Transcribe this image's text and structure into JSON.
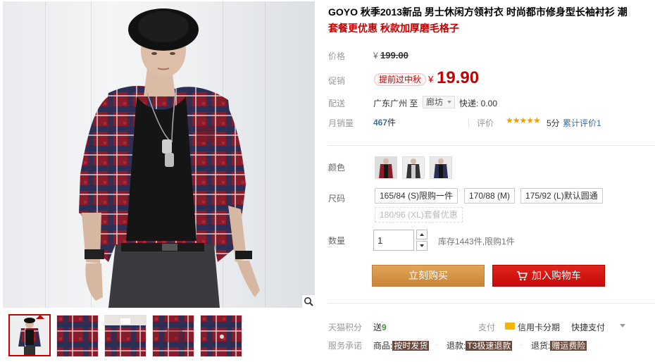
{
  "product": {
    "title": "GOYO 秋季2013新品 男士休闲方领衬衣 时尚都市修身型长袖衬衫 潮",
    "subtitle": "套餐更优惠 秋款加厚磨毛格子"
  },
  "price": {
    "label": "价格",
    "currency": "¥",
    "original": "199.00",
    "promo_label": "促销",
    "promo_tag": "提前过中秋",
    "current": "19.90"
  },
  "shipping": {
    "label": "配送",
    "from": "广东广州",
    "to_word": "至",
    "to_city": "廊坊",
    "fee": "快递: 0.00"
  },
  "sales": {
    "label": "月销量",
    "count": "467",
    "unit": "件",
    "rating_label": "评价",
    "stars": "★★★★★",
    "score": "5分",
    "review_count": "累计评价1"
  },
  "sku": {
    "color_label": "颜色",
    "size_label": "尺码",
    "sizes": [
      "165/84 (S)限购一件",
      "170/88 (M)",
      "175/92 (L)默认圆通",
      "180/96 (XL)套餐优惠"
    ]
  },
  "quantity": {
    "label": "数量",
    "value": "1",
    "stock": "库存1443件,限购1件"
  },
  "actions": {
    "buy_now": "立刻购买",
    "add_to_cart": "加入购物车"
  },
  "footer": {
    "points_label": "天猫积分",
    "points_prefix": "送",
    "points_value": "9",
    "pay_label": "支付",
    "credit": "信用卡分期",
    "quick_pay": "快捷支付",
    "service_label": "服务承诺",
    "svc1_prefix": "商品:",
    "svc1_tag": "按时发货",
    "svc2_prefix": "退款:",
    "svc2_tag": "T3极速退款",
    "svc3_prefix": "退货:",
    "svc3_tag": "赠运费险"
  },
  "icons": {
    "zoom": "magnifier-icon",
    "cart": "cart-icon",
    "credit": "credit-card-icon"
  },
  "colors": {
    "accent_red": "#c40000",
    "buy_orange": "#d99a4a",
    "cart_red": "#c50a0a",
    "link_blue": "#3d6ea3",
    "star_gold": "#f0a000"
  }
}
